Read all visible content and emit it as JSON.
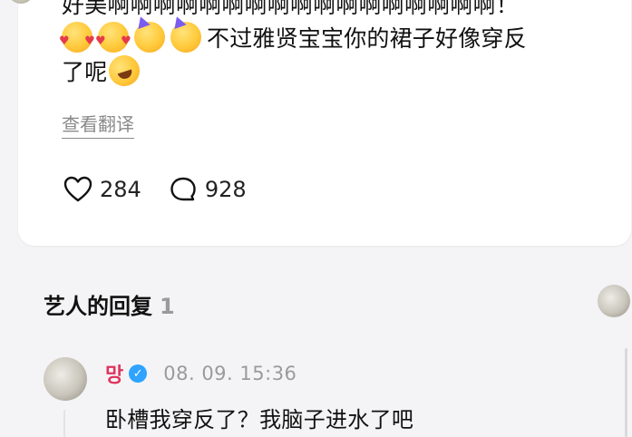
{
  "comment": {
    "text_line1": "好美啊啊啊啊啊啊啊啊啊啊啊啊啊啊啊啊啊！",
    "text_line2_suffix": "不过雅贤宝宝你的裙子好像穿反",
    "text_line3": "了呢",
    "emojis": [
      "smiling-face-with-hearts",
      "smiling-face-with-hearts",
      "partying-face",
      "partying-face",
      "rolling-on-the-floor-laughing"
    ],
    "translate_label": "查看翻译",
    "likes": "284",
    "replies": "928"
  },
  "artist_reply_section": {
    "title": "艺人的回复",
    "count": "1"
  },
  "reply": {
    "author": "망",
    "verified": true,
    "timestamp": "08. 09. 15:36",
    "text": "卧槽我穿反了？我脑子进水了吧"
  },
  "colors": {
    "background": "#f4f4f6",
    "card": "#ffffff",
    "author_name": "#e0335c",
    "verified_badge": "#2fa3ff",
    "muted_text": "#9a9a9a"
  }
}
